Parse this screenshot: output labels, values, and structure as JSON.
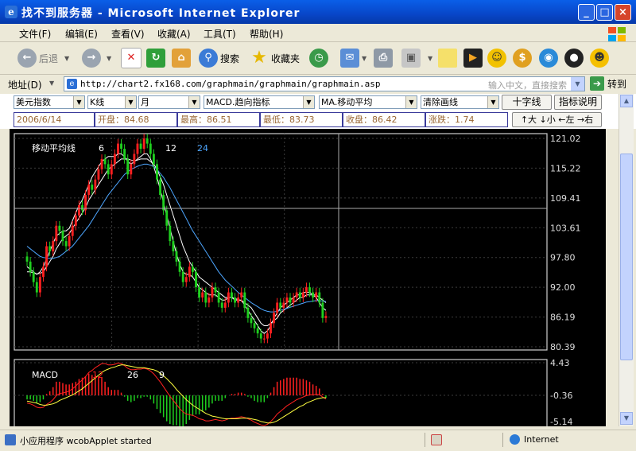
{
  "window": {
    "title": "找不到服务器 - Microsoft Internet Explorer"
  },
  "menu": [
    "文件(F)",
    "编辑(E)",
    "查看(V)",
    "收藏(A)",
    "工具(T)",
    "帮助(H)"
  ],
  "toolbar": {
    "back": "后退",
    "search": "搜索",
    "favorites": "收藏夹"
  },
  "address": {
    "label": "地址(D)",
    "url": "http://chart2.fx168.com/graphmain/graphmain/graphmain.asp",
    "search_hint": "输入中文，直接搜索",
    "go": "转到"
  },
  "controls": {
    "symbol": "美元指数",
    "chart_type": "K线",
    "period": "月",
    "indicator": "MACD.趋向指标",
    "ma": "MA.移动平均",
    "clear": "清除画线",
    "crosshair": "十字线",
    "help": "指标说明"
  },
  "quote": {
    "date": "2006/6/14",
    "open": "开盘：84.68",
    "high": "最高：86.51",
    "low": "最低：83.73",
    "close": "收盘：86.42",
    "change": "涨跌：1.74"
  },
  "nav": {
    "up": "↑大",
    "down": "↓小",
    "left": "←左",
    "right": "→右"
  },
  "chart_data": [
    {
      "type": "candlestick",
      "label": "移动平均线",
      "ma_periods": [
        {
          "label": "6",
          "color": "#ffffff"
        },
        {
          "label": "12",
          "color": "#ffffff"
        },
        {
          "label": "24",
          "color": "#4da6ff"
        }
      ],
      "y_ticks": [
        "121.02",
        "115.22",
        "109.41",
        "103.61",
        "97.80",
        "92.00",
        "86.19",
        "80.39"
      ],
      "ylim": [
        80.39,
        121.02
      ],
      "up_color": "#ff2020",
      "down_color": "#1fd01f",
      "closes": [
        97,
        95,
        93,
        91,
        94,
        96,
        100,
        99,
        101,
        104,
        103,
        101,
        100,
        102,
        104,
        106,
        108,
        107,
        110,
        112,
        111,
        113,
        115,
        117,
        116,
        114,
        116,
        118,
        120,
        119,
        117,
        114,
        116,
        118,
        120,
        119,
        121,
        120,
        118,
        116,
        113,
        110,
        107,
        104,
        101,
        99,
        97,
        95,
        93,
        94,
        96,
        95,
        92,
        90,
        91,
        89,
        90,
        92,
        91,
        89,
        88,
        89,
        91,
        90,
        89,
        90,
        91,
        88,
        86,
        85,
        84,
        83,
        82,
        82,
        83,
        85,
        87,
        89,
        88,
        89,
        90,
        89,
        90,
        91,
        90,
        91,
        92,
        91,
        90,
        91,
        89,
        86,
        86.4
      ],
      "ma6": [
        96,
        95.5,
        95,
        94.5,
        95,
        96,
        97.5,
        99,
        100.5,
        102,
        102.5,
        103,
        103,
        103.5,
        105,
        106.5,
        108,
        109,
        110.5,
        112,
        113.5,
        114.5,
        115.5,
        116.5,
        117,
        117.5,
        117.5,
        117.5,
        118,
        118,
        117.5,
        116.5,
        116,
        116.5,
        117,
        117.5,
        118,
        118,
        117,
        115.5,
        113.5,
        111,
        108.5,
        106,
        103.5,
        101,
        98.5,
        96.5,
        95,
        94.5,
        94.5,
        94,
        93,
        92,
        91.5,
        91,
        90.5,
        90.5,
        90.5,
        90,
        89.5,
        89.5,
        90,
        90,
        89.5,
        89.5,
        89.5,
        88.5,
        87.5,
        86.5,
        85.5,
        84.5,
        83.5,
        83,
        83.5,
        84.5,
        86,
        87,
        88,
        88.5,
        89,
        89.5,
        90,
        90.5,
        90.5,
        91,
        91,
        91,
        90.5,
        90,
        89,
        88,
        87.5
      ],
      "ma12": [
        95,
        95,
        94.8,
        94.6,
        94.7,
        95,
        96,
        97,
        98,
        99.5,
        100.5,
        101.5,
        102,
        102.5,
        103.5,
        104.5,
        105.5,
        106.5,
        107.5,
        109,
        110,
        111,
        112,
        113,
        114,
        115,
        115.5,
        116,
        116.5,
        117,
        117,
        117,
        116.8,
        116.6,
        116.8,
        117,
        117,
        117,
        116.5,
        116,
        115,
        113.5,
        112,
        110,
        108,
        106,
        104,
        102,
        100,
        98.5,
        97,
        96,
        95,
        94,
        93.5,
        93,
        92.5,
        92,
        91.5,
        91,
        90.5,
        90,
        90,
        90,
        89.8,
        89.6,
        89.4,
        89,
        88.5,
        88,
        87,
        86,
        85,
        84.5,
        84.5,
        85,
        85.5,
        86,
        87,
        87.5,
        88,
        88.5,
        89,
        89.5,
        90,
        90,
        90.5,
        90.5,
        90.5,
        90.5,
        90,
        89.5,
        89
      ],
      "ma24": [
        100,
        99.5,
        99,
        98.5,
        98,
        97.8,
        97.7,
        97.6,
        97.6,
        97.8,
        98,
        98.5,
        99,
        99.5,
        100,
        100.8,
        101.6,
        102.4,
        103.2,
        104,
        105,
        106,
        107,
        108,
        109,
        110,
        110.8,
        111.6,
        112.4,
        113.2,
        114,
        114.5,
        115,
        115.3,
        115.6,
        115.8,
        116,
        116,
        115.8,
        115.5,
        115,
        114.2,
        113.4,
        112.4,
        111.4,
        110.2,
        109,
        107.8,
        106.6,
        105.4,
        104.2,
        103,
        102,
        101,
        100,
        99,
        98,
        97,
        96,
        95,
        94.2,
        93.4,
        92.8,
        92.2,
        91.6,
        91,
        90.5,
        90,
        89.5,
        89,
        88.6,
        88.2,
        87.8,
        87.5,
        87.3,
        87.2,
        87.2,
        87.3,
        87.5,
        87.7,
        87.9,
        88.1,
        88.3,
        88.5,
        88.7,
        88.9,
        89.1,
        89.2,
        89.3,
        89.4,
        89.4,
        89.3,
        89.2
      ]
    },
    {
      "type": "macd",
      "label": "MACD",
      "params": [
        {
          "label": "12",
          "color": "#ff2020"
        },
        {
          "label": "26",
          "color": "#ffffff"
        },
        {
          "label": "9",
          "color": "#ffffff"
        }
      ],
      "y_ticks": [
        "4.43",
        "-0.36",
        "-5.14"
      ],
      "ylim": [
        -5.14,
        4.43
      ],
      "dif": [
        -1.5,
        -1.6,
        -1.8,
        -2.1,
        -2.2,
        -2.1,
        -1.7,
        -1.4,
        -1.0,
        -0.4,
        -0.1,
        0.0,
        0.1,
        0.3,
        0.6,
        1.0,
        1.5,
        1.9,
        2.4,
        3.0,
        3.3,
        3.7,
        4.0,
        4.3,
        4.3,
        4.1,
        4.1,
        4.2,
        4.4,
        4.3,
        4.0,
        3.6,
        3.4,
        3.4,
        3.5,
        3.5,
        3.6,
        3.5,
        3.2,
        2.8,
        2.2,
        1.6,
        0.9,
        0.2,
        -0.5,
        -1.1,
        -1.7,
        -2.3,
        -2.8,
        -3.1,
        -3.2,
        -3.3,
        -3.5,
        -3.8,
        -3.9,
        -4.1,
        -4.1,
        -4.0,
        -3.9,
        -4.0,
        -4.1,
        -4.0,
        -3.8,
        -3.7,
        -3.7,
        -3.6,
        -3.5,
        -3.6,
        -3.8,
        -4.0,
        -4.3,
        -4.5,
        -4.7,
        -4.8,
        -4.6,
        -4.2,
        -3.7,
        -3.1,
        -2.7,
        -2.3,
        -1.9,
        -1.6,
        -1.3,
        -1.0,
        -0.8,
        -0.6,
        -0.4,
        -0.3,
        -0.3,
        -0.2,
        -0.3,
        -0.6,
        -0.9
      ],
      "dea": [
        -1.2,
        -1.3,
        -1.4,
        -1.5,
        -1.7,
        -1.8,
        -1.8,
        -1.7,
        -1.6,
        -1.4,
        -1.1,
        -0.9,
        -0.7,
        -0.5,
        -0.3,
        0.0,
        0.3,
        0.6,
        1.0,
        1.4,
        1.8,
        2.2,
        2.6,
        3.0,
        3.3,
        3.5,
        3.7,
        3.8,
        4.0,
        4.1,
        4.1,
        4.0,
        3.9,
        3.8,
        3.7,
        3.7,
        3.7,
        3.6,
        3.5,
        3.4,
        3.2,
        2.9,
        2.5,
        2.1,
        1.6,
        1.1,
        0.5,
        0.0,
        -0.5,
        -1.0,
        -1.4,
        -1.8,
        -2.1,
        -2.4,
        -2.7,
        -3.0,
        -3.2,
        -3.4,
        -3.5,
        -3.6,
        -3.7,
        -3.8,
        -3.8,
        -3.8,
        -3.8,
        -3.8,
        -3.7,
        -3.7,
        -3.7,
        -3.8,
        -3.9,
        -4.0,
        -4.2,
        -4.3,
        -4.4,
        -4.4,
        -4.3,
        -4.1,
        -3.8,
        -3.5,
        -3.2,
        -2.9,
        -2.6,
        -2.3,
        -2.0,
        -1.8,
        -1.5,
        -1.3,
        -1.1,
        -0.9,
        -0.8,
        -0.7,
        -0.7
      ]
    }
  ],
  "status": {
    "text": "小应用程序 wcobApplet started",
    "zone": "Internet"
  }
}
